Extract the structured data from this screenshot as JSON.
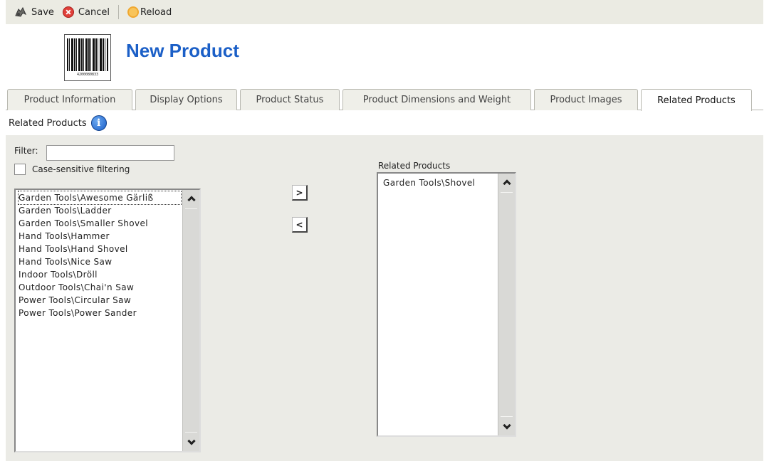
{
  "toolbar": {
    "save": "Save",
    "cancel": "Cancel",
    "reload": "Reload"
  },
  "header": {
    "title": "New Product",
    "barcode_number": "4200080833"
  },
  "tabs": [
    {
      "label": "Product Information",
      "active": false
    },
    {
      "label": "Display Options",
      "active": false
    },
    {
      "label": "Product Status",
      "active": false
    },
    {
      "label": "Product Dimensions and Weight",
      "active": false
    },
    {
      "label": "Product Images",
      "active": false
    },
    {
      "label": "Related Products",
      "active": true
    }
  ],
  "section": {
    "label": "Related Products"
  },
  "filter": {
    "label": "Filter:",
    "value": "",
    "case_label": "Case-sensitive filtering",
    "case_checked": false
  },
  "available": {
    "items": [
      "Garden Tools\\Awesome Gärliß",
      "Garden Tools\\Ladder",
      "Garden Tools\\Smaller Shovel",
      "Hand Tools\\Hammer",
      "Hand Tools\\Hand Shovel",
      "Hand Tools\\Nice Saw",
      "Indoor Tools\\Dröll",
      "Outdoor Tools\\Chai'n Saw",
      "Power Tools\\Circular Saw",
      "Power Tools\\Power Sander"
    ]
  },
  "buttons": {
    "add": ">",
    "remove": "<"
  },
  "related": {
    "label": "Related Products",
    "items": [
      "Garden Tools\\Shovel"
    ]
  }
}
